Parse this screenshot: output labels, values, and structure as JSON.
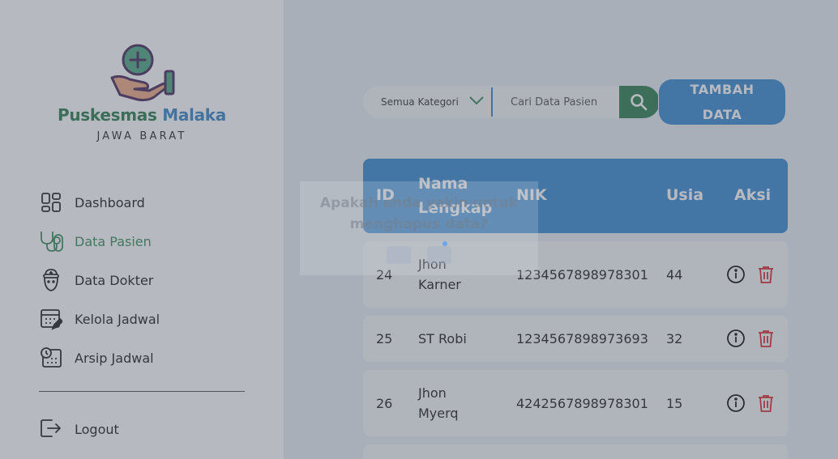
{
  "brand": {
    "name_part1": "Puskesmas",
    "name_part2": "Malaka",
    "region": "JAWA BARAT"
  },
  "nav": {
    "items": [
      {
        "label": "Dashboard",
        "icon": "dashboard-icon",
        "active": false
      },
      {
        "label": "Data Pasien",
        "icon": "stethoscope-icon",
        "active": true
      },
      {
        "label": "Data Dokter",
        "icon": "doctor-icon",
        "active": false
      },
      {
        "label": "Kelola Jadwal",
        "icon": "calendar-edit-icon",
        "active": false
      },
      {
        "label": "Arsip Jadwal",
        "icon": "calendar-clock-icon",
        "active": false
      }
    ],
    "logout": "Logout"
  },
  "search": {
    "category": "Semua Kategori",
    "placeholder": "Cari Data Pasien"
  },
  "add_button": "TAMBAH DATA",
  "table": {
    "headers": {
      "id": "ID",
      "name": "Nama Lengkap",
      "nik": "NIK",
      "age": "Usia",
      "action": "Aksi"
    },
    "rows": [
      {
        "id": "24",
        "name": "Jhon Karner",
        "nik": "1234567898978301",
        "age": "44"
      },
      {
        "id": "25",
        "name": "ST Robi",
        "nik": "1234567898973693",
        "age": "32"
      },
      {
        "id": "26",
        "name": "Jhon Myerq",
        "nik": "4242567898978301",
        "age": "15"
      }
    ]
  },
  "dialog": {
    "message": "Apakah anda yakin untuk menghapus data?"
  },
  "colors": {
    "primary_blue": "#3a8bd0",
    "primary_green": "#2f7d4f",
    "delete_red": "#d9262e"
  }
}
